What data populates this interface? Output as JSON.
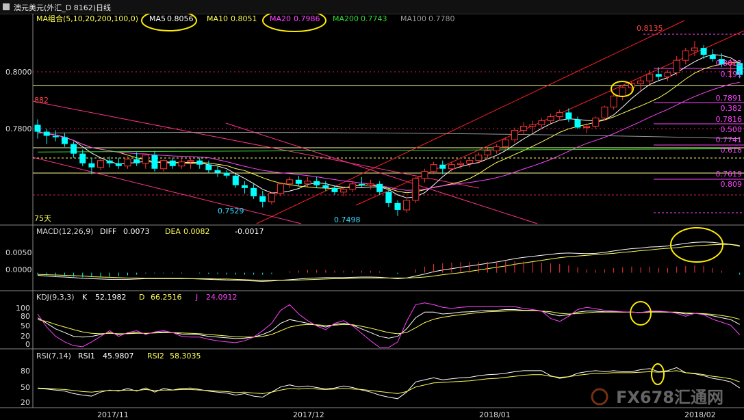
{
  "window": {
    "title": "澳元美元(外汇_D 8162)日线"
  },
  "chart_data": [
    {
      "panel": "price",
      "type": "candlestick",
      "indicator": {
        "name": "MA组合(5,10,20,200,100,0)",
        "series": [
          {
            "label": "MA5",
            "value": "0.8056",
            "color": "#ffffff"
          },
          {
            "label": "MA10",
            "value": "0.8051",
            "color": "#ffff55"
          },
          {
            "label": "MA20",
            "value": "0.7986",
            "color": "#ff44ff"
          },
          {
            "label": "MA200",
            "value": "0.7743",
            "color": "#33dd33"
          },
          {
            "label": "MA100",
            "value": "0.7780",
            "color": "#999999"
          }
        ]
      },
      "y_ticks": [
        "0.8000",
        "0.7800"
      ],
      "ylim": [
        0.747,
        0.8185
      ],
      "x_ticks": [
        "2017/11",
        "2017/12",
        "2018/01",
        "2018/02"
      ],
      "annotations": {
        "high_left": "882",
        "low1": "0.7529",
        "low2": "0.7498",
        "high": "0.8135",
        "days": "75天"
      },
      "fib_labels": [
        "0.8012",
        "0.191",
        "0.7891",
        "0.382",
        "0.7816",
        "0.500",
        "0.7741",
        "0.618",
        "0.7619",
        "0.809"
      ],
      "colors": {
        "up": "#ff3333",
        "down": "#00ffff"
      },
      "candles": [
        [
          0.783,
          0.785,
          0.778,
          0.7805
        ],
        [
          0.7805,
          0.7815,
          0.776,
          0.779
        ],
        [
          0.779,
          0.781,
          0.777,
          0.7785
        ],
        [
          0.7785,
          0.78,
          0.775,
          0.776
        ],
        [
          0.776,
          0.777,
          0.771,
          0.7725
        ],
        [
          0.7725,
          0.774,
          0.768,
          0.769
        ],
        [
          0.769,
          0.771,
          0.765,
          0.7675
        ],
        [
          0.7675,
          0.7705,
          0.7665,
          0.77
        ],
        [
          0.77,
          0.7715,
          0.7675,
          0.769
        ],
        [
          0.769,
          0.771,
          0.767,
          0.768
        ],
        [
          0.768,
          0.7715,
          0.767,
          0.7705
        ],
        [
          0.7705,
          0.773,
          0.768,
          0.769
        ],
        [
          0.769,
          0.7725,
          0.767,
          0.772
        ],
        [
          0.772,
          0.7735,
          0.766,
          0.767
        ],
        [
          0.767,
          0.7705,
          0.766,
          0.77
        ],
        [
          0.77,
          0.771,
          0.767,
          0.768
        ],
        [
          0.768,
          0.7705,
          0.767,
          0.7695
        ],
        [
          0.7695,
          0.771,
          0.767,
          0.77
        ],
        [
          0.77,
          0.771,
          0.767,
          0.7685
        ],
        [
          0.7685,
          0.77,
          0.7655,
          0.7665
        ],
        [
          0.7665,
          0.768,
          0.764,
          0.7655
        ],
        [
          0.7655,
          0.7665,
          0.7635,
          0.7645
        ],
        [
          0.7645,
          0.765,
          0.76,
          0.761
        ],
        [
          0.761,
          0.7625,
          0.758,
          0.76
        ],
        [
          0.76,
          0.7615,
          0.756,
          0.757
        ],
        [
          0.757,
          0.759,
          0.7529,
          0.755
        ],
        [
          0.755,
          0.7585,
          0.754,
          0.758
        ],
        [
          0.758,
          0.762,
          0.757,
          0.7615
        ],
        [
          0.7615,
          0.764,
          0.76,
          0.763
        ],
        [
          0.763,
          0.7645,
          0.7605,
          0.7615
        ],
        [
          0.7615,
          0.764,
          0.7605,
          0.7625
        ],
        [
          0.7625,
          0.764,
          0.76,
          0.761
        ],
        [
          0.761,
          0.7625,
          0.759,
          0.76
        ],
        [
          0.76,
          0.761,
          0.7575,
          0.7585
        ],
        [
          0.7585,
          0.7605,
          0.757,
          0.7595
        ],
        [
          0.7595,
          0.7625,
          0.7585,
          0.7615
        ],
        [
          0.7615,
          0.764,
          0.76,
          0.761
        ],
        [
          0.761,
          0.763,
          0.7595,
          0.7615
        ],
        [
          0.7615,
          0.7625,
          0.7575,
          0.7585
        ],
        [
          0.7585,
          0.7595,
          0.753,
          0.7545
        ],
        [
          0.7545,
          0.7555,
          0.7498,
          0.752
        ],
        [
          0.752,
          0.756,
          0.751,
          0.7555
        ],
        [
          0.7555,
          0.764,
          0.7545,
          0.7635
        ],
        [
          0.7635,
          0.767,
          0.762,
          0.766
        ],
        [
          0.766,
          0.7695,
          0.765,
          0.7685
        ],
        [
          0.7685,
          0.77,
          0.765,
          0.767
        ],
        [
          0.767,
          0.7695,
          0.766,
          0.7685
        ],
        [
          0.7685,
          0.77,
          0.767,
          0.769
        ],
        [
          0.769,
          0.771,
          0.7675,
          0.77
        ],
        [
          0.77,
          0.773,
          0.769,
          0.772
        ],
        [
          0.772,
          0.7745,
          0.7705,
          0.7735
        ],
        [
          0.7735,
          0.776,
          0.7725,
          0.775
        ],
        [
          0.775,
          0.7785,
          0.774,
          0.7775
        ],
        [
          0.7775,
          0.782,
          0.7765,
          0.781
        ],
        [
          0.781,
          0.784,
          0.7795,
          0.7825
        ],
        [
          0.7825,
          0.7845,
          0.78,
          0.783
        ],
        [
          0.783,
          0.7855,
          0.7815,
          0.7845
        ],
        [
          0.7845,
          0.787,
          0.7835,
          0.786
        ],
        [
          0.786,
          0.7885,
          0.7845,
          0.7875
        ],
        [
          0.7875,
          0.789,
          0.784,
          0.785
        ],
        [
          0.785,
          0.786,
          0.7815,
          0.782
        ],
        [
          0.782,
          0.7835,
          0.78,
          0.7825
        ],
        [
          0.7825,
          0.786,
          0.7815,
          0.7855
        ],
        [
          0.7855,
          0.79,
          0.7845,
          0.7895
        ],
        [
          0.7895,
          0.7945,
          0.7885,
          0.7935
        ],
        [
          0.7935,
          0.7975,
          0.792,
          0.7965
        ],
        [
          0.7965,
          0.799,
          0.795,
          0.798
        ],
        [
          0.798,
          0.8005,
          0.7955,
          0.799
        ],
        [
          0.799,
          0.803,
          0.7975,
          0.8015
        ],
        [
          0.8015,
          0.804,
          0.799,
          0.8005
        ],
        [
          0.8005,
          0.803,
          0.799,
          0.802
        ],
        [
          0.802,
          0.808,
          0.801,
          0.8065
        ],
        [
          0.8065,
          0.811,
          0.805,
          0.81
        ],
        [
          0.81,
          0.8135,
          0.808,
          0.811
        ],
        [
          0.811,
          0.812,
          0.807,
          0.8085
        ],
        [
          0.8085,
          0.8105,
          0.806,
          0.807
        ],
        [
          0.807,
          0.809,
          0.804,
          0.805
        ],
        [
          0.805,
          0.807,
          0.8,
          0.8055
        ],
        [
          0.8055,
          0.806,
          0.8,
          0.8012
        ]
      ]
    },
    {
      "panel": "macd",
      "type": "line",
      "indicator": {
        "name": "MACD(12,26,9)",
        "series": [
          {
            "label": "DIFF",
            "value": "0.0073",
            "color": "#ffffff"
          },
          {
            "label": "DEA",
            "value": "0.0082",
            "color": "#ffff55"
          },
          {
            "label": "",
            "value": "-0.0017",
            "color": "#ffffff"
          }
        ]
      },
      "y_ticks": [
        "0.0050",
        "0.0000"
      ],
      "ylim": [
        -0.005,
        0.011
      ],
      "diff": [
        -0.0008,
        -0.001,
        -0.0012,
        -0.0013,
        -0.0015,
        -0.0017,
        -0.0018,
        -0.0019,
        -0.002,
        -0.002,
        -0.002,
        -0.0019,
        -0.0018,
        -0.0018,
        -0.0018,
        -0.0018,
        -0.0018,
        -0.0018,
        -0.0019,
        -0.002,
        -0.0021,
        -0.0022,
        -0.0023,
        -0.0024,
        -0.0025,
        -0.0026,
        -0.0025,
        -0.0023,
        -0.0021,
        -0.0019,
        -0.0017,
        -0.0016,
        -0.0015,
        -0.0015,
        -0.0015,
        -0.0014,
        -0.0013,
        -0.0013,
        -0.0014,
        -0.0016,
        -0.0018,
        -0.0016,
        -0.001,
        -0.0004,
        0.0003,
        0.0008,
        0.0012,
        0.0016,
        0.002,
        0.0024,
        0.0028,
        0.0032,
        0.0037,
        0.0042,
        0.0046,
        0.0049,
        0.0052,
        0.0055,
        0.0058,
        0.0059,
        0.0058,
        0.0057,
        0.0058,
        0.0061,
        0.0065,
        0.0069,
        0.0072,
        0.0074,
        0.0077,
        0.0078,
        0.008,
        0.0084,
        0.0088,
        0.0091,
        0.0092,
        0.0091,
        0.0088,
        0.0085,
        0.0079
      ],
      "dea": [
        -0.0005,
        -0.0006,
        -0.0007,
        -0.0008,
        -0.0009,
        -0.001,
        -0.0012,
        -0.0013,
        -0.0014,
        -0.0015,
        -0.0016,
        -0.0016,
        -0.0017,
        -0.0017,
        -0.0017,
        -0.0017,
        -0.0017,
        -0.0018,
        -0.0018,
        -0.0018,
        -0.0019,
        -0.0019,
        -0.002,
        -0.0021,
        -0.0022,
        -0.0023,
        -0.0023,
        -0.0023,
        -0.0023,
        -0.0022,
        -0.0021,
        -0.002,
        -0.0019,
        -0.0018,
        -0.0018,
        -0.0017,
        -0.0016,
        -0.0016,
        -0.0016,
        -0.0016,
        -0.0016,
        -0.0016,
        -0.0015,
        -0.0013,
        -0.001,
        -0.0006,
        -0.0003,
        0.0,
        0.0004,
        0.0008,
        0.0012,
        0.0016,
        0.002,
        0.0025,
        0.0029,
        0.0033,
        0.0037,
        0.0041,
        0.0045,
        0.0048,
        0.005,
        0.0052,
        0.0054,
        0.0056,
        0.0058,
        0.0061,
        0.0063,
        0.0066,
        0.0068,
        0.0071,
        0.0073,
        0.0075,
        0.0078,
        0.008,
        0.0082,
        0.0084,
        0.0085,
        0.0085,
        0.0082
      ]
    },
    {
      "panel": "kdj",
      "type": "line",
      "indicator": {
        "name": "KDJ(9,3,3)",
        "series": [
          {
            "label": "K",
            "value": "52.1982",
            "color": "#ffffff"
          },
          {
            "label": "D",
            "value": "66.2516",
            "color": "#ffff55"
          },
          {
            "label": "J",
            "value": "24.0912",
            "color": "#ff44ff"
          }
        ]
      },
      "y_ticks": [
        "100",
        "80",
        "50",
        "20",
        "0"
      ],
      "ylim": [
        -10,
        115
      ],
      "k": [
        70,
        55,
        40,
        30,
        20,
        18,
        20,
        25,
        30,
        25,
        28,
        30,
        27,
        30,
        32,
        30,
        26,
        25,
        24,
        20,
        18,
        16,
        14,
        15,
        18,
        25,
        35,
        55,
        65,
        60,
        55,
        50,
        45,
        52,
        55,
        50,
        40,
        30,
        20,
        15,
        20,
        40,
        70,
        85,
        85,
        80,
        82,
        85,
        86,
        88,
        90,
        90,
        92,
        92,
        90,
        90,
        88,
        80,
        75,
        78,
        85,
        88,
        88,
        86,
        86,
        85,
        85,
        84,
        86,
        86,
        85,
        84,
        80,
        82,
        80,
        75,
        70,
        65,
        52
      ],
      "d": [
        65,
        60,
        52,
        45,
        38,
        32,
        28,
        27,
        28,
        27,
        27,
        28,
        28,
        29,
        30,
        30,
        29,
        28,
        27,
        25,
        23,
        21,
        19,
        18,
        18,
        20,
        25,
        35,
        45,
        50,
        52,
        51,
        49,
        50,
        52,
        51,
        47,
        42,
        36,
        30,
        27,
        30,
        43,
        57,
        66,
        71,
        75,
        78,
        81,
        84,
        86,
        87,
        88,
        89,
        89,
        89,
        88,
        86,
        82,
        80,
        81,
        83,
        85,
        85,
        85,
        85,
        85,
        84,
        85,
        85,
        85,
        85,
        83,
        82,
        81,
        79,
        76,
        72,
        66
      ],
      "j": [
        80,
        45,
        20,
        5,
        -5,
        -8,
        5,
        20,
        35,
        20,
        30,
        35,
        25,
        32,
        35,
        30,
        20,
        18,
        18,
        12,
        8,
        5,
        3,
        8,
        18,
        35,
        55,
        90,
        105,
        80,
        62,
        48,
        38,
        55,
        62,
        48,
        28,
        8,
        -10,
        -10,
        5,
        60,
        105,
        110,
        105,
        98,
        95,
        98,
        100,
        100,
        100,
        100,
        100,
        100,
        95,
        92,
        88,
        68,
        60,
        74,
        92,
        98,
        94,
        90,
        88,
        86,
        85,
        84,
        88,
        88,
        86,
        82,
        74,
        82,
        78,
        66,
        58,
        50,
        24
      ]
    },
    {
      "panel": "rsi",
      "type": "line",
      "indicator": {
        "name": "RSI(7,14)",
        "series": [
          {
            "label": "RSI1",
            "value": "45.9807",
            "color": "#ffffff"
          },
          {
            "label": "RSI2",
            "value": "58.3035",
            "color": "#ffff55"
          }
        ]
      },
      "y_ticks": [
        "80",
        "50",
        "20"
      ],
      "ylim": [
        10,
        100
      ],
      "rsi1": [
        45,
        44,
        42,
        40,
        35,
        32,
        30,
        38,
        42,
        40,
        45,
        40,
        46,
        38,
        45,
        42,
        45,
        46,
        43,
        40,
        38,
        36,
        32,
        35,
        30,
        28,
        38,
        48,
        52,
        48,
        50,
        47,
        44,
        46,
        50,
        47,
        42,
        38,
        32,
        28,
        25,
        38,
        58,
        62,
        66,
        62,
        64,
        66,
        67,
        70,
        72,
        73,
        75,
        78,
        80,
        80,
        80,
        70,
        65,
        68,
        75,
        78,
        80,
        78,
        80,
        78,
        78,
        82,
        84,
        78,
        80,
        86,
        76,
        74,
        70,
        65,
        62,
        58,
        46
      ],
      "rsi2": [
        46,
        45,
        44,
        43,
        41,
        39,
        38,
        40,
        41,
        41,
        42,
        41,
        43,
        41,
        42,
        42,
        43,
        43,
        42,
        41,
        40,
        39,
        37,
        38,
        36,
        35,
        38,
        42,
        45,
        44,
        45,
        44,
        43,
        44,
        45,
        44,
        43,
        41,
        39,
        37,
        35,
        39,
        48,
        52,
        56,
        57,
        58,
        59,
        60,
        62,
        64,
        65,
        67,
        69,
        71,
        72,
        72,
        69,
        67,
        68,
        71,
        73,
        75,
        75,
        76,
        76,
        76,
        77,
        78,
        77,
        78,
        80,
        76,
        75,
        72,
        69,
        67,
        64,
        58
      ]
    }
  ],
  "watermark": {
    "text": "FX678汇通网"
  }
}
